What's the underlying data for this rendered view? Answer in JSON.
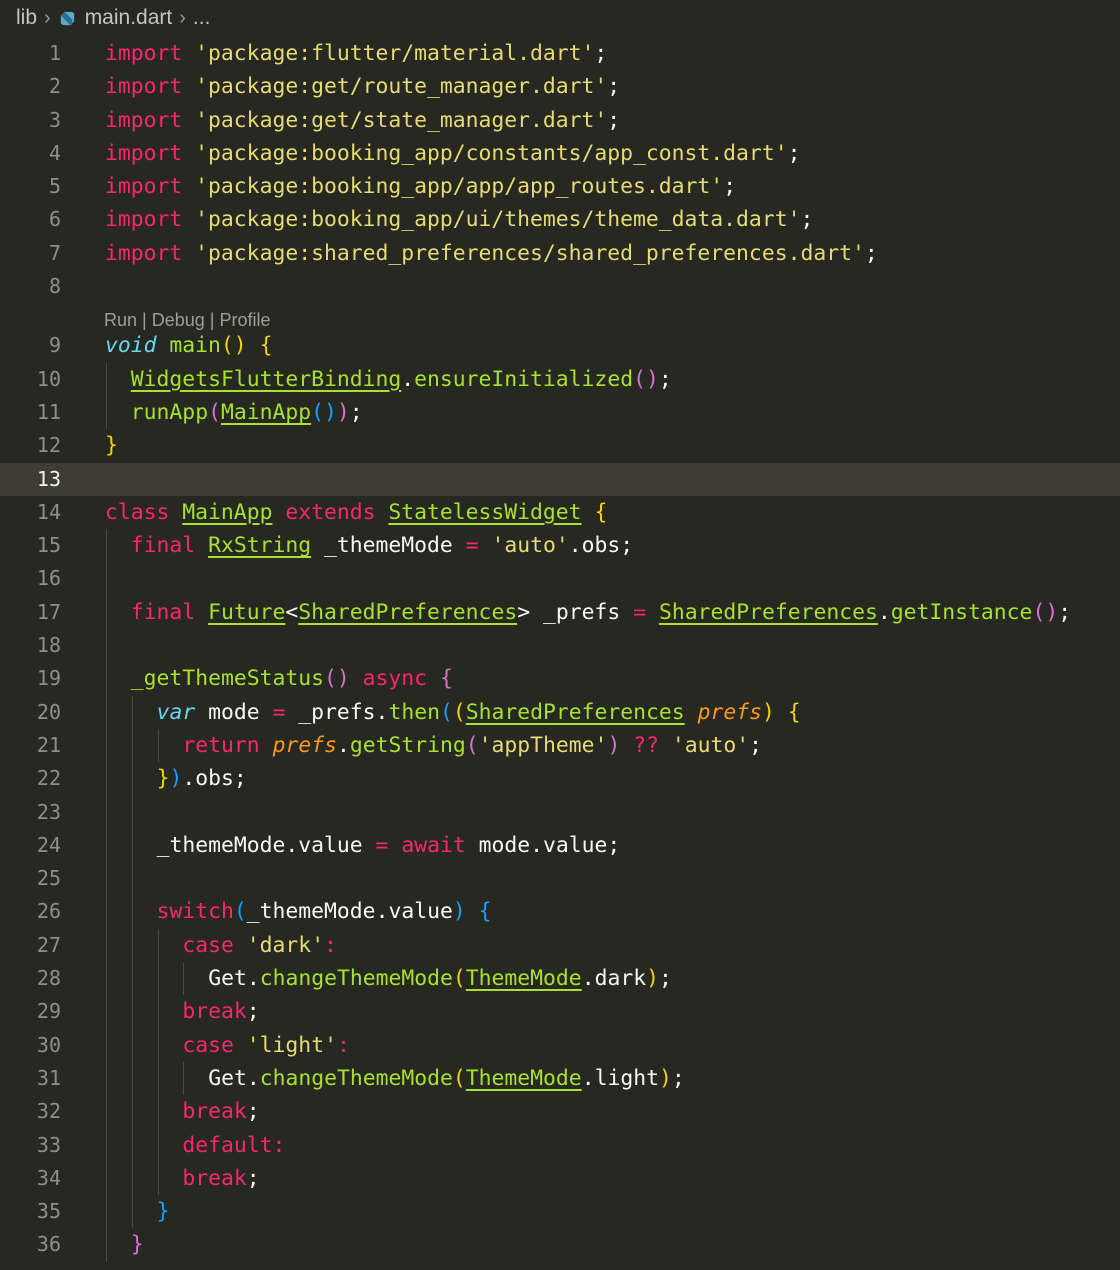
{
  "breadcrumb": {
    "folder": "lib",
    "file": "main.dart",
    "more": "..."
  },
  "codelens": {
    "run": "Run",
    "sep1": " | ",
    "debug": "Debug",
    "sep2": " | ",
    "profile": "Profile",
    "before_line": 9
  },
  "editor": {
    "current_line": 13,
    "language": "dart",
    "lines": [
      {
        "n": "1",
        "indent": 0,
        "tokens": [
          [
            "kw",
            "import"
          ],
          [
            "plain",
            " "
          ],
          [
            "str",
            "'package:flutter/material.dart'"
          ],
          [
            "plain",
            ";"
          ]
        ]
      },
      {
        "n": "2",
        "indent": 0,
        "tokens": [
          [
            "kw",
            "import"
          ],
          [
            "plain",
            " "
          ],
          [
            "str",
            "'package:get/route_manager.dart'"
          ],
          [
            "plain",
            ";"
          ]
        ]
      },
      {
        "n": "3",
        "indent": 0,
        "tokens": [
          [
            "kw",
            "import"
          ],
          [
            "plain",
            " "
          ],
          [
            "str",
            "'package:get/state_manager.dart'"
          ],
          [
            "plain",
            ";"
          ]
        ]
      },
      {
        "n": "4",
        "indent": 0,
        "tokens": [
          [
            "kw",
            "import"
          ],
          [
            "plain",
            " "
          ],
          [
            "str",
            "'package:booking_app/constants/app_const.dart'"
          ],
          [
            "plain",
            ";"
          ]
        ]
      },
      {
        "n": "5",
        "indent": 0,
        "tokens": [
          [
            "kw",
            "import"
          ],
          [
            "plain",
            " "
          ],
          [
            "str",
            "'package:booking_app/app/app_routes.dart'"
          ],
          [
            "plain",
            ";"
          ]
        ]
      },
      {
        "n": "6",
        "indent": 0,
        "tokens": [
          [
            "kw",
            "import"
          ],
          [
            "plain",
            " "
          ],
          [
            "str",
            "'package:booking_app/ui/themes/theme_data.dart'"
          ],
          [
            "plain",
            ";"
          ]
        ]
      },
      {
        "n": "7",
        "indent": 0,
        "tokens": [
          [
            "kw",
            "import"
          ],
          [
            "plain",
            " "
          ],
          [
            "str",
            "'package:shared_preferences/shared_preferences.dart'"
          ],
          [
            "plain",
            ";"
          ]
        ]
      },
      {
        "n": "8",
        "indent": 0,
        "tokens": []
      },
      {
        "n": "9",
        "indent": 0,
        "tokens": [
          [
            "kwi",
            "void"
          ],
          [
            "plain",
            " "
          ],
          [
            "fn",
            "main"
          ],
          [
            "p1",
            "()"
          ],
          [
            "plain",
            " "
          ],
          [
            "p1",
            "{"
          ]
        ]
      },
      {
        "n": "10",
        "indent": 1,
        "tokens": [
          [
            "type",
            "WidgetsFlutterBinding"
          ],
          [
            "plain",
            "."
          ],
          [
            "fn",
            "ensureInitialized"
          ],
          [
            "p2",
            "()"
          ],
          [
            "plain",
            ";"
          ]
        ]
      },
      {
        "n": "11",
        "indent": 1,
        "tokens": [
          [
            "fn",
            "runApp"
          ],
          [
            "p2",
            "("
          ],
          [
            "type",
            "MainApp"
          ],
          [
            "p3",
            "()"
          ],
          [
            "p2",
            ")"
          ],
          [
            "plain",
            ";"
          ]
        ]
      },
      {
        "n": "12",
        "indent": 0,
        "tokens": [
          [
            "p1",
            "}"
          ]
        ]
      },
      {
        "n": "13",
        "indent": 0,
        "tokens": []
      },
      {
        "n": "14",
        "indent": 0,
        "tokens": [
          [
            "kw",
            "class"
          ],
          [
            "plain",
            " "
          ],
          [
            "type",
            "MainApp"
          ],
          [
            "plain",
            " "
          ],
          [
            "kw",
            "extends"
          ],
          [
            "plain",
            " "
          ],
          [
            "type",
            "StatelessWidget"
          ],
          [
            "plain",
            " "
          ],
          [
            "p1",
            "{"
          ]
        ]
      },
      {
        "n": "15",
        "indent": 1,
        "tokens": [
          [
            "kw",
            "final"
          ],
          [
            "plain",
            " "
          ],
          [
            "type",
            "RxString"
          ],
          [
            "plain",
            " "
          ],
          [
            "var",
            "_themeMode"
          ],
          [
            "plain",
            " "
          ],
          [
            "op",
            "="
          ],
          [
            "plain",
            " "
          ],
          [
            "str",
            "'auto'"
          ],
          [
            "plain",
            ".obs;"
          ]
        ]
      },
      {
        "n": "16",
        "indent": 1,
        "tokens": []
      },
      {
        "n": "17",
        "indent": 1,
        "tokens": [
          [
            "kw",
            "final"
          ],
          [
            "plain",
            " "
          ],
          [
            "type",
            "Future"
          ],
          [
            "plain",
            "<"
          ],
          [
            "type",
            "SharedPreferences"
          ],
          [
            "plain",
            ">"
          ],
          [
            "plain",
            " "
          ],
          [
            "var",
            "_prefs"
          ],
          [
            "plain",
            " "
          ],
          [
            "op",
            "="
          ],
          [
            "plain",
            " "
          ],
          [
            "type",
            "SharedPreferences"
          ],
          [
            "plain",
            "."
          ],
          [
            "fn",
            "getInstance"
          ],
          [
            "p2",
            "()"
          ],
          [
            "plain",
            ";"
          ]
        ]
      },
      {
        "n": "18",
        "indent": 1,
        "tokens": []
      },
      {
        "n": "19",
        "indent": 1,
        "tokens": [
          [
            "fn",
            "_getThemeStatus"
          ],
          [
            "p2",
            "()"
          ],
          [
            "plain",
            " "
          ],
          [
            "kw",
            "async"
          ],
          [
            "plain",
            " "
          ],
          [
            "p2",
            "{"
          ]
        ]
      },
      {
        "n": "20",
        "indent": 2,
        "tokens": [
          [
            "kwi",
            "var"
          ],
          [
            "plain",
            " mode "
          ],
          [
            "op",
            "="
          ],
          [
            "plain",
            " _prefs."
          ],
          [
            "fn",
            "then"
          ],
          [
            "p3",
            "("
          ],
          [
            "p1",
            "("
          ],
          [
            "type",
            "SharedPreferences"
          ],
          [
            "plain",
            " "
          ],
          [
            "param",
            "prefs"
          ],
          [
            "p1",
            ")"
          ],
          [
            "plain",
            " "
          ],
          [
            "p1",
            "{"
          ]
        ]
      },
      {
        "n": "21",
        "indent": 3,
        "tokens": [
          [
            "kw",
            "return"
          ],
          [
            "plain",
            " "
          ],
          [
            "param",
            "prefs"
          ],
          [
            "plain",
            "."
          ],
          [
            "fn",
            "getString"
          ],
          [
            "p2",
            "("
          ],
          [
            "str",
            "'appTheme'"
          ],
          [
            "p2",
            ")"
          ],
          [
            "plain",
            " "
          ],
          [
            "op",
            "??"
          ],
          [
            "plain",
            " "
          ],
          [
            "str",
            "'auto'"
          ],
          [
            "plain",
            ";"
          ]
        ]
      },
      {
        "n": "22",
        "indent": 2,
        "tokens": [
          [
            "p1",
            "}"
          ],
          [
            "p3",
            ")"
          ],
          [
            "plain",
            ".obs;"
          ]
        ]
      },
      {
        "n": "23",
        "indent": 2,
        "tokens": []
      },
      {
        "n": "24",
        "indent": 2,
        "tokens": [
          [
            "var",
            "_themeMode"
          ],
          [
            "plain",
            ".value "
          ],
          [
            "op",
            "="
          ],
          [
            "plain",
            " "
          ],
          [
            "kw",
            "await"
          ],
          [
            "plain",
            " mode.value;"
          ]
        ]
      },
      {
        "n": "25",
        "indent": 2,
        "tokens": []
      },
      {
        "n": "26",
        "indent": 2,
        "tokens": [
          [
            "kw",
            "switch"
          ],
          [
            "p3",
            "("
          ],
          [
            "var",
            "_themeMode"
          ],
          [
            "plain",
            ".value"
          ],
          [
            "p3",
            ")"
          ],
          [
            "plain",
            " "
          ],
          [
            "p3",
            "{"
          ]
        ]
      },
      {
        "n": "27",
        "indent": 3,
        "tokens": [
          [
            "kw",
            "case"
          ],
          [
            "plain",
            " "
          ],
          [
            "str",
            "'dark'"
          ],
          [
            "op",
            ":"
          ]
        ]
      },
      {
        "n": "28",
        "indent": 4,
        "tokens": [
          [
            "plain",
            "Get."
          ],
          [
            "fn",
            "changeThemeMode"
          ],
          [
            "p1",
            "("
          ],
          [
            "type",
            "ThemeMode"
          ],
          [
            "plain",
            ".dark"
          ],
          [
            "p1",
            ")"
          ],
          [
            "plain",
            ";"
          ]
        ]
      },
      {
        "n": "29",
        "indent": 3,
        "tokens": [
          [
            "kw",
            "break"
          ],
          [
            "plain",
            ";"
          ]
        ]
      },
      {
        "n": "30",
        "indent": 3,
        "tokens": [
          [
            "kw",
            "case"
          ],
          [
            "plain",
            " "
          ],
          [
            "str",
            "'light'"
          ],
          [
            "op",
            ":"
          ]
        ]
      },
      {
        "n": "31",
        "indent": 4,
        "tokens": [
          [
            "plain",
            "Get."
          ],
          [
            "fn",
            "changeThemeMode"
          ],
          [
            "p1",
            "("
          ],
          [
            "type",
            "ThemeMode"
          ],
          [
            "plain",
            ".light"
          ],
          [
            "p1",
            ")"
          ],
          [
            "plain",
            ";"
          ]
        ]
      },
      {
        "n": "32",
        "indent": 3,
        "tokens": [
          [
            "kw",
            "break"
          ],
          [
            "plain",
            ";"
          ]
        ]
      },
      {
        "n": "33",
        "indent": 3,
        "tokens": [
          [
            "kw",
            "default"
          ],
          [
            "op",
            ":"
          ]
        ]
      },
      {
        "n": "34",
        "indent": 3,
        "tokens": [
          [
            "kw",
            "break"
          ],
          [
            "plain",
            ";"
          ]
        ]
      },
      {
        "n": "35",
        "indent": 2,
        "tokens": [
          [
            "p3",
            "}"
          ]
        ]
      },
      {
        "n": "36",
        "indent": 1,
        "tokens": [
          [
            "p2",
            "}"
          ]
        ]
      }
    ]
  },
  "colors": {
    "background": "#272822",
    "current_line_bg": "#3e3d32",
    "keyword": "#f92672",
    "string": "#e6db74",
    "function": "#a6e22e",
    "storage": "#66d9ef",
    "parameter": "#fd971f",
    "bracket_1": "#f1d700",
    "bracket_2": "#da70d6",
    "bracket_3": "#179fff"
  }
}
